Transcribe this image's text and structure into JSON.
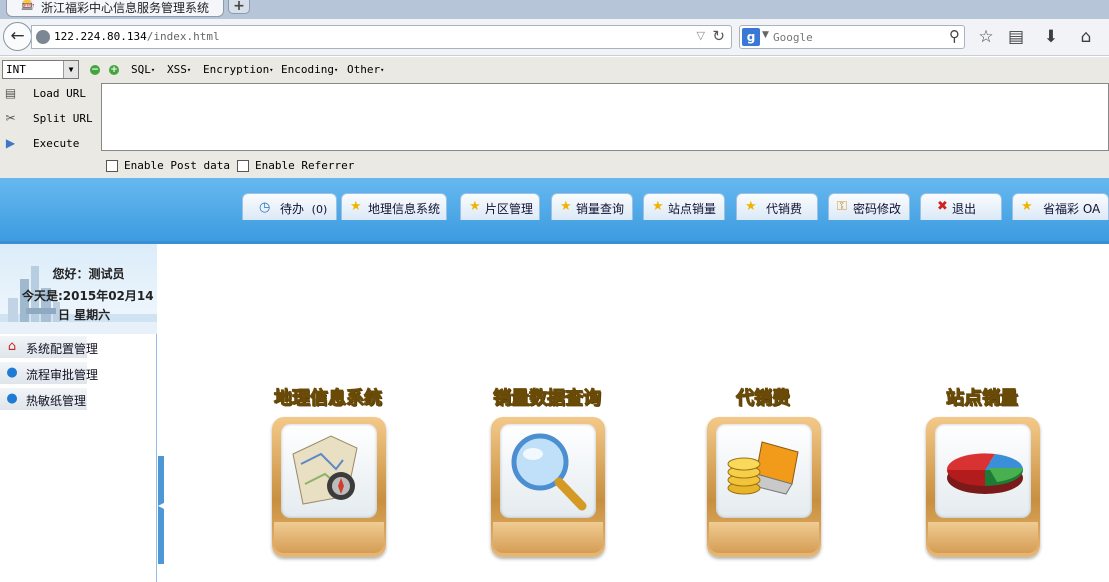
{
  "browser": {
    "tab_title": "浙江福彩中心信息服务管理系统",
    "url_host": "122.224.80.134",
    "url_path": "/index.html",
    "search_engine": "g",
    "search_placeholder": "Google"
  },
  "hackbar": {
    "select_value": "INT",
    "menus": [
      "SQL",
      "XSS",
      "Encryption",
      "Encoding",
      "Other"
    ],
    "buttons": [
      "Load URL",
      "Split URL",
      "Execute"
    ],
    "checkboxes": [
      "Enable Post data",
      "Enable Referrer"
    ]
  },
  "header": {
    "tabs": [
      {
        "label": "待办",
        "icon": "clock-icon"
      },
      {
        "label": "地理信息系统",
        "icon": "star-icon"
      },
      {
        "label": "片区管理",
        "icon": "star-icon"
      },
      {
        "label": "销量查询",
        "icon": "star-icon"
      },
      {
        "label": "站点销量",
        "icon": "star-icon"
      },
      {
        "label": "代销费",
        "icon": "star-icon"
      },
      {
        "label": "密码修改",
        "icon": "key-icon"
      },
      {
        "label": "退出",
        "icon": "close-icon"
      },
      {
        "label": "省福彩 OA",
        "icon": "star-icon"
      }
    ],
    "todo_count": "(0)"
  },
  "sidebar": {
    "greeting": "您好：测试员",
    "date_line1": "今天是:2015年02月14",
    "date_line2": "日  星期六",
    "items": [
      {
        "label": "系统配置管理",
        "icon": "house-icon"
      },
      {
        "label": "流程审批管理",
        "icon": "bulb-icon"
      },
      {
        "label": "热敏纸管理",
        "icon": "bulb-icon"
      }
    ]
  },
  "main": {
    "features": [
      {
        "title": "地理信息系统",
        "icon": "map-compass-icon"
      },
      {
        "title": "销量数据查询",
        "icon": "magnifier-icon"
      },
      {
        "title": "代销费",
        "icon": "coins-laptop-icon"
      },
      {
        "title": "站点销量",
        "icon": "pie-chart-icon"
      }
    ]
  },
  "colors": {
    "header_blue": "#3d9be0",
    "hackbar_bg": "#ebe9e4",
    "feature_gold": "#f6c62a"
  }
}
